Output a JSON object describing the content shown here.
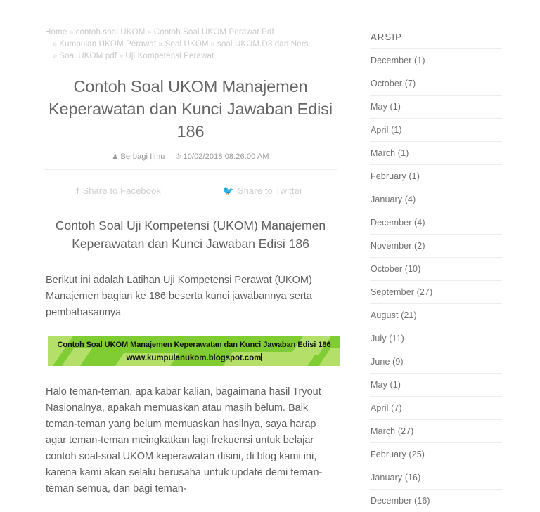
{
  "breadcrumb": {
    "separator": "»",
    "items": [
      "Home",
      "contoh soal UKOM",
      "Contoh Soal UKOM Perawat Pdf",
      "Kumpulan UKOM Perawat",
      "Soal UKOM",
      "soal UKOM D3 dan Ners",
      "Soal UKOM pdf",
      "Uji Kompetensi Perawat"
    ]
  },
  "post": {
    "title": "Contoh Soal UKOM Manajemen Keperawatan dan Kunci Jawaban Edisi 186",
    "author": "Berbagi Ilmu",
    "author_icon": "user-icon",
    "date": "10/02/2018 08:26:00 AM",
    "date_icon": "clock-icon",
    "heading": "Contoh Soal Uji Kompetensi (UKOM) Manajemen Keperawatan dan Kunci Jawaban Edisi 186",
    "intro": "Berikut ini adalah Latihan Uji Kompetensi Perawat (UKOM) Manajemen bagian ke 186 beserta kunci jawabannya serta pembahasannya",
    "body": "Halo teman-teman, apa kabar kalian, bagaimana hasil Tryout Nasionalnya, apakah memuaskan atau masih belum. Baik teman-teman yang belum memuaskan hasilnya, saya harap agar teman-teman meingkatkan lagi frekuensi untuk belajar contoh soal-soal UKOM keperawatan disini, di blog kami ini, karena kami akan selalu berusaha untuk update demi teman-teman semua, dan bagi teman-"
  },
  "share": {
    "facebook": {
      "label": "Share to Facebook",
      "icon": "facebook-icon",
      "glyph": "f"
    },
    "twitter": {
      "label": "Share to Twitter",
      "icon": "twitter-icon",
      "glyph": "🐦"
    }
  },
  "banner": {
    "line1": "Contoh Soal UKOM Manajemen Keperawatan dan Kunci Jawaban Edisi 186",
    "line2": "www.kumpulanukom.blogspot.com",
    "bg_color": "#7fcc33",
    "stripe_color": "#b4e06a",
    "text_color": "#111111"
  },
  "sidebar": {
    "widget_title": "ARSIP",
    "archive": [
      {
        "label": "December (1)"
      },
      {
        "label": "October (7)"
      },
      {
        "label": "May (1)"
      },
      {
        "label": "April (1)"
      },
      {
        "label": "March (1)"
      },
      {
        "label": "February (1)"
      },
      {
        "label": "January (4)"
      },
      {
        "label": "December (4)"
      },
      {
        "label": "November (2)"
      },
      {
        "label": "October (10)"
      },
      {
        "label": "September (27)"
      },
      {
        "label": "August (21)"
      },
      {
        "label": "July (11)"
      },
      {
        "label": "June (9)"
      },
      {
        "label": "May (1)"
      },
      {
        "label": "April (7)"
      },
      {
        "label": "March (27)"
      },
      {
        "label": "February (25)"
      },
      {
        "label": "January (16)"
      },
      {
        "label": "December (16)"
      }
    ]
  }
}
